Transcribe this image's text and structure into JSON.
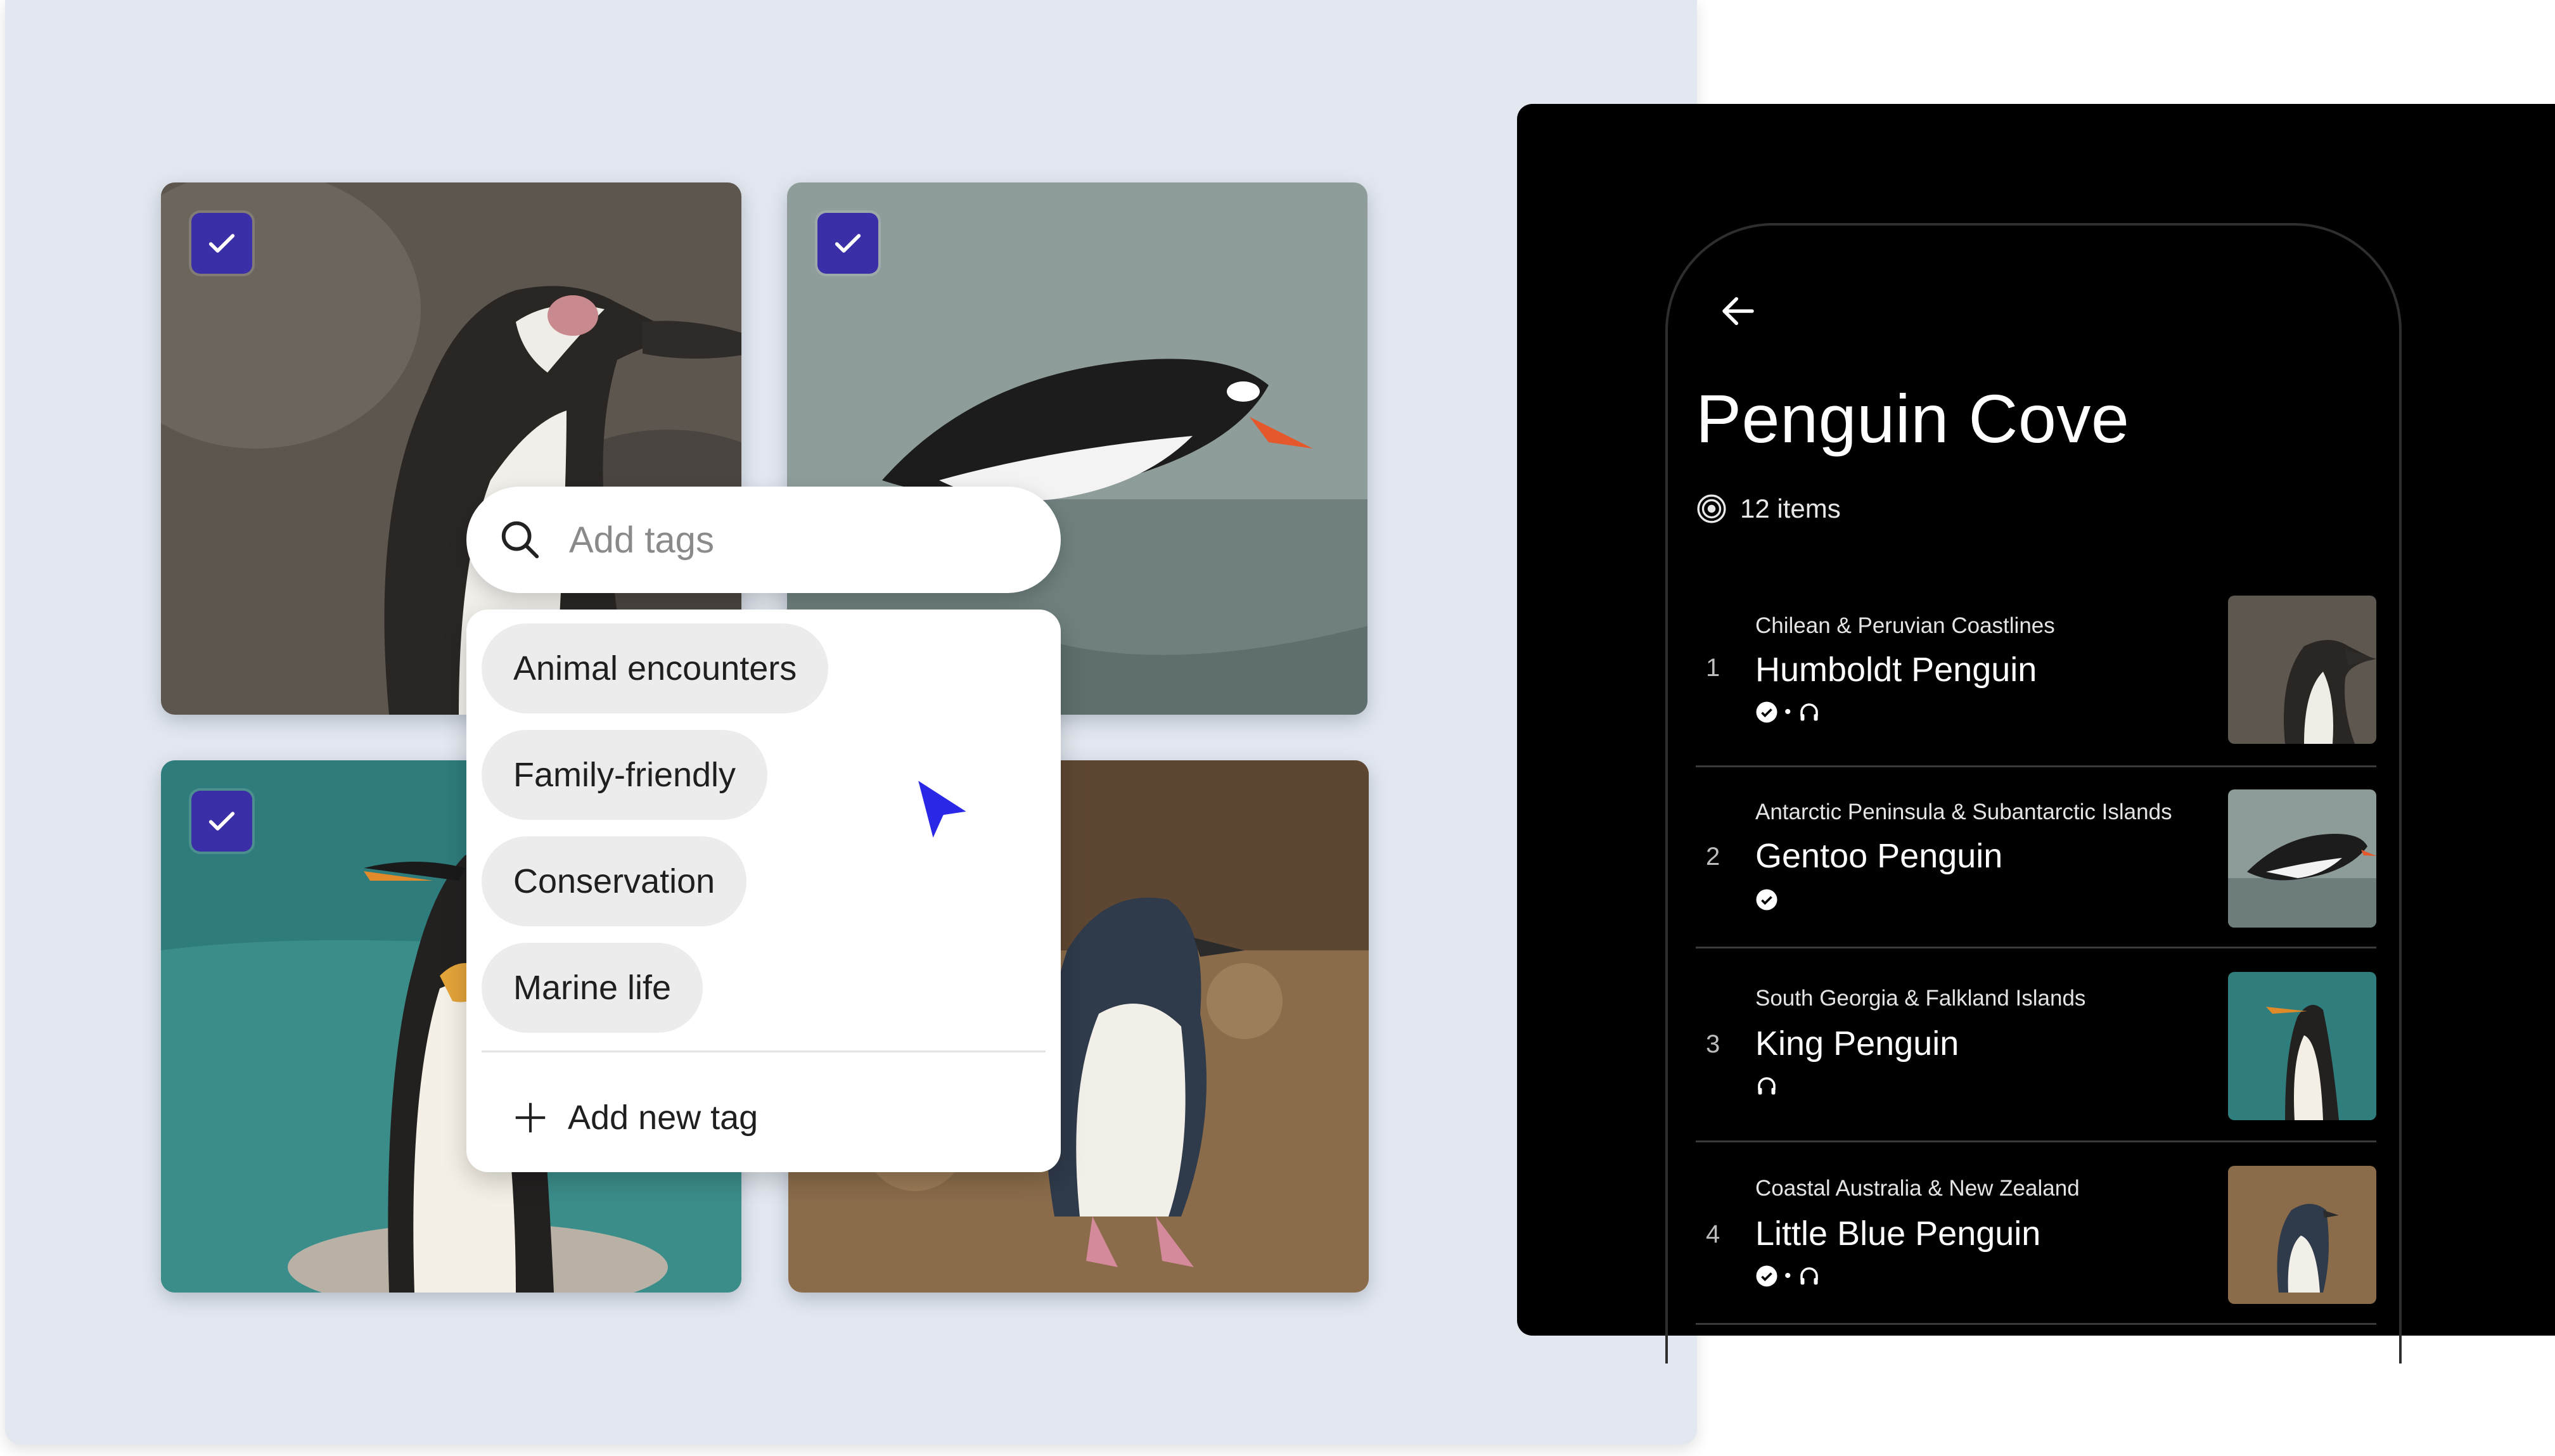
{
  "search": {
    "placeholder": "Add tags"
  },
  "tags": [
    "Animal encounters",
    "Family-friendly",
    "Conservation",
    "Marine life"
  ],
  "add_new_tag_label": "Add new tag",
  "photos": [
    {
      "alt": "Humboldt penguin",
      "selected": true
    },
    {
      "alt": "Gentoo penguin",
      "selected": true
    },
    {
      "alt": "King penguin",
      "selected": true
    },
    {
      "alt": "Little blue penguin",
      "selected": false
    }
  ],
  "collection": {
    "title": "Penguin Cove",
    "item_count": "12 items",
    "items": [
      {
        "num": "1",
        "region": "Chilean & Peruvian Coastlines",
        "name": "Humboldt Penguin",
        "icons": [
          "verified-icon",
          "headphones-icon"
        ]
      },
      {
        "num": "2",
        "region": "Antarctic Peninsula & Subantarctic Islands",
        "name": "Gentoo Penguin",
        "icons": [
          "verified-icon"
        ]
      },
      {
        "num": "3",
        "region": "South Georgia & Falkland Islands",
        "name": "King Penguin",
        "icons": [
          "headphones-icon"
        ]
      },
      {
        "num": "4",
        "region": "Coastal Australia & New Zealand",
        "name": "Little Blue Penguin",
        "icons": [
          "verified-icon",
          "headphones-icon"
        ]
      }
    ]
  },
  "colors": {
    "accent": "#3b2fa8",
    "cursor": "#2a27e6",
    "panel_bg": "#e3e8f0"
  }
}
